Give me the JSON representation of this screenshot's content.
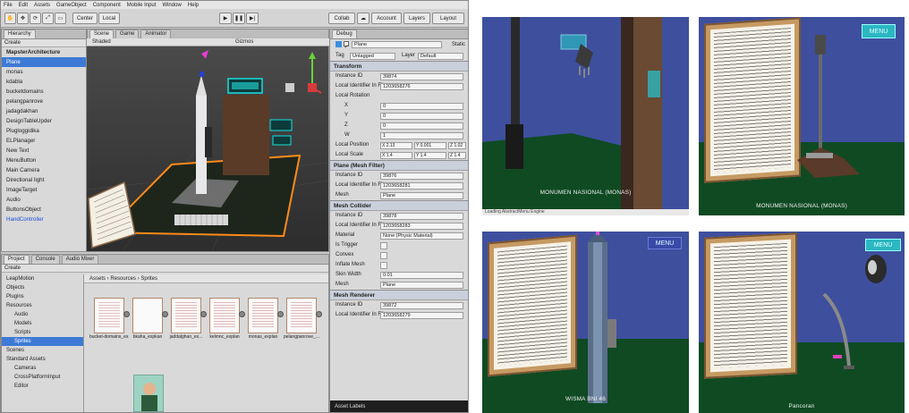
{
  "unity": {
    "menu": [
      "File",
      "Edit",
      "Assets",
      "GameObject",
      "Component",
      "Mobile Input",
      "Window",
      "Help"
    ],
    "toolbar": {
      "center_btn": "Center",
      "local_btn": "Local",
      "collab_btn": "Collab",
      "account_btn": "Account",
      "layers_btn": "Layers",
      "layout_btn": "Layout"
    },
    "hierarchy": {
      "tab": "Hierarchy",
      "create": "Create",
      "scene_name": "MapsterArchitecture",
      "items": [
        "Plane",
        "monas",
        "kdabla",
        "bucketdomains",
        "pelangpanrove",
        "jadagdakhan",
        "DesignTableUpder",
        "Plugloggidika",
        "ELPlanager",
        "New Text",
        "MenuButton",
        "Main Camera",
        "Directional light",
        "ImageTarget",
        "Audio",
        "ButtonsObject",
        "HandController"
      ]
    },
    "scene": {
      "tabs": [
        "Scene",
        "Game",
        "Animator"
      ],
      "shaded": "Shaded",
      "gizmos": "Gizmos"
    },
    "inspector": {
      "tab": "Debug",
      "object_name": "Plane",
      "static_label": "Static",
      "tag_label": "Tag",
      "tag_value": "Untagged",
      "layer_label": "Layer",
      "layer_value": "Default",
      "transform_title": "Transform",
      "transform_rows": [
        {
          "label": "Instance ID",
          "value": "39874"
        },
        {
          "label": "Local Identifier In File",
          "value": "1203658276"
        },
        {
          "label": "Local Rotation",
          "value": ""
        },
        {
          "label": "X",
          "value": "0"
        },
        {
          "label": "Y",
          "value": "0"
        },
        {
          "label": "Z",
          "value": "0"
        },
        {
          "label": "W",
          "value": "1"
        }
      ],
      "local_position": {
        "label": "Local Position",
        "x": "X 2.13",
        "y": "Y 0.001",
        "z": "Z 1.02"
      },
      "local_scale": {
        "label": "Local Scale",
        "x": "X 1.4",
        "y": "Y 1.4",
        "z": "Z 1.4"
      },
      "mesh_filter_title": "Plane (Mesh Filter)",
      "mesh_filter_rows": [
        {
          "label": "Instance ID",
          "value": "39876"
        },
        {
          "label": "Local Identifier In File",
          "value": "1203658281"
        },
        {
          "label": "Mesh",
          "value": "Plane"
        }
      ],
      "mesh_collider_title": "Mesh Collider",
      "mesh_collider_rows": [
        {
          "label": "Instance ID",
          "value": "39878"
        },
        {
          "label": "Local Identifier In File",
          "value": "1203658283"
        },
        {
          "label": "Material",
          "value": "None (Physic Material)"
        },
        {
          "label": "Is Trigger",
          "value": ""
        },
        {
          "label": "Convex",
          "value": ""
        },
        {
          "label": "Inflate Mesh",
          "value": ""
        },
        {
          "label": "Skin Width",
          "value": "0.01"
        },
        {
          "label": "Mesh",
          "value": "Plane"
        }
      ],
      "mesh_renderer_title": "Mesh Renderer",
      "mesh_renderer_rows": [
        {
          "label": "Instance ID",
          "value": "39872"
        },
        {
          "label": "Local Identifier In File",
          "value": "1203658279"
        }
      ],
      "asset_labels": "Asset Labels"
    },
    "project": {
      "tabs": [
        "Project",
        "Console",
        "Audio Mixer"
      ],
      "create": "Create",
      "breadcrumb": "Assets › Resources › Sprites",
      "tree": [
        "LeapMotion",
        "Objects",
        "Plugins",
        "Resources",
        "Audio",
        "Models",
        "Scripts",
        "Sprites",
        "Scenes",
        "Standard Assets",
        "Cameras",
        "CrossPlatformInput",
        "Editor"
      ],
      "assets": [
        "bucket-domains_ex...",
        "bkaha_expkan",
        "jaddalghan_ex...",
        "kelmnc_explan",
        "monas_explan",
        "pelangpanrove_..."
      ]
    }
  },
  "screenshots": [
    {
      "caption": "MONUMEN NASIONAL (MONAS)",
      "menu": "",
      "statusbar": "Loading  AbstractMenu Engine"
    },
    {
      "caption": "MONUMEN NASIONAL (MONAS)",
      "menu": "MENU"
    },
    {
      "caption": "WISMA BNI 46",
      "menu": "MENU"
    },
    {
      "caption": "Pancoran",
      "menu": "MENU"
    }
  ],
  "colors": {
    "sky": "#3e4f9e",
    "ground": "#0f4a23",
    "menu_button": "#2bb7c1",
    "unity_selection": "#3d7ad6",
    "unity_panel": "#d9d9d9"
  }
}
